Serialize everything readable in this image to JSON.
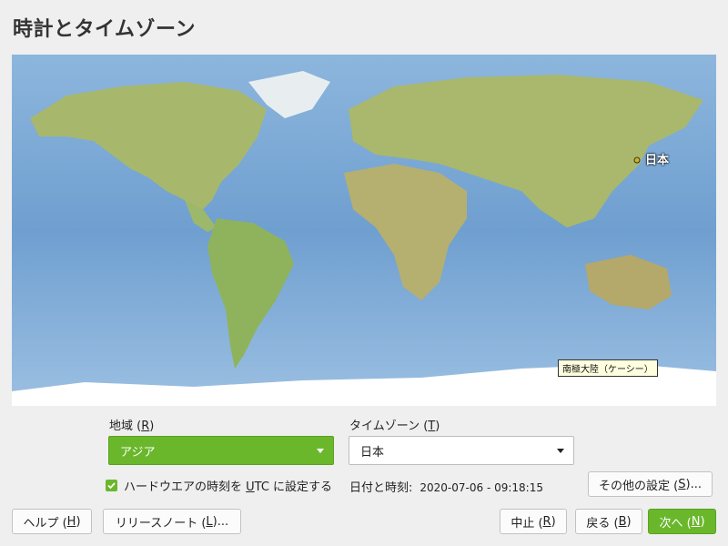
{
  "title": "時計とタイムゾーン",
  "map": {
    "city_label": "日本",
    "tooltip": "南極大陸（ケーシー）"
  },
  "region": {
    "label": "地域 (R)",
    "label_parts": [
      "地域 (",
      "R",
      ")"
    ],
    "value": "アジア"
  },
  "timezone": {
    "label_parts": [
      "タイムゾーン (",
      "T",
      ")"
    ],
    "value": "日本"
  },
  "hwclock": {
    "checked": true,
    "label_parts": [
      "ハードウエアの時刻を ",
      "U",
      "TC に設定する"
    ]
  },
  "datetime": {
    "label": "日付と時刻:",
    "value": "2020-07-06 - 09:18:15"
  },
  "buttons": {
    "other_settings": [
      "その他の設定 (",
      "S",
      ")..."
    ],
    "help": [
      "ヘルプ (",
      "H",
      ")"
    ],
    "release_notes": [
      "リリースノート (",
      "L",
      ")..."
    ],
    "abort": [
      "中止 (",
      "R",
      ")"
    ],
    "back": [
      "戻る (",
      "B",
      ")"
    ],
    "next": [
      "次へ (",
      "N",
      ")"
    ]
  },
  "colors": {
    "accent": "#6ab72c",
    "ocean": "#7fa9d4",
    "land": "#9cb86a",
    "ice": "#ffffff"
  }
}
